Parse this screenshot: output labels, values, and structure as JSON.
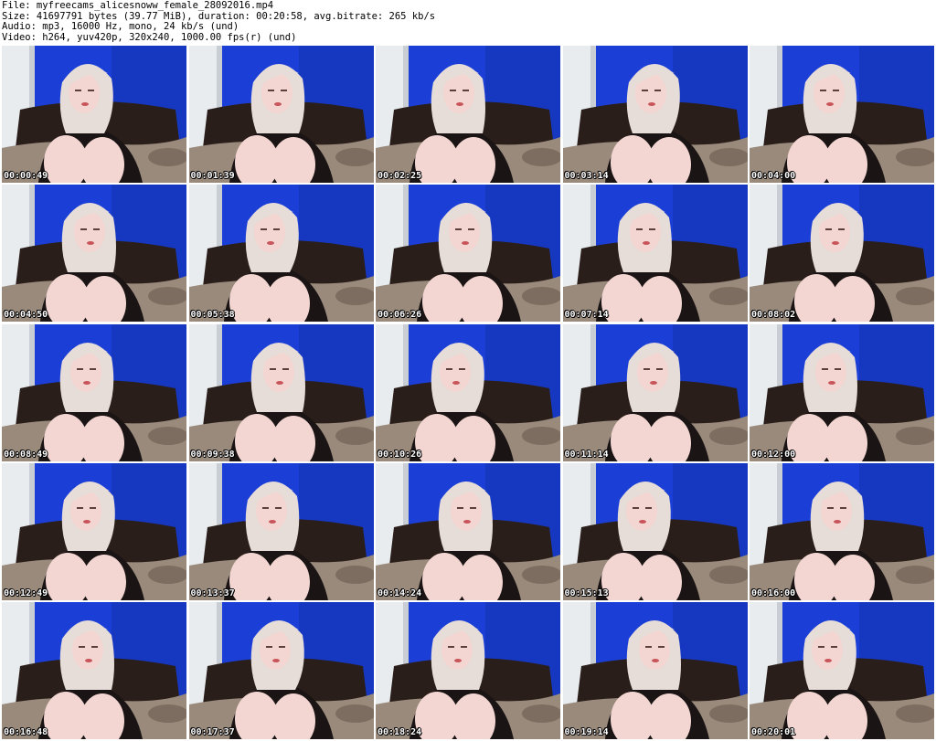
{
  "header": {
    "file_line": "File: myfreecams_alicesnoww_female_28092016.mp4",
    "size_line": "Size: 41697791 bytes (39.77 MiB), duration: 00:20:58, avg.bitrate: 265 kb/s",
    "audio_line": "Audio: mp3, 16000 Hz, mono, 24 kb/s (und)",
    "video_line": "Video: h264, yuv420p, 320x240, 1000.00 fps(r) (und)"
  },
  "colors": {
    "wall_blue": "#1b3fd6",
    "wall_blue_dark": "#0f2a9a",
    "door_white": "#e8ecef",
    "hair": "#e6dcd8",
    "skin": "#f3d6d2",
    "shirt": "#1a1414",
    "headboard": "#2a1e1a",
    "bedding": "#9a8a7c"
  },
  "thumbnails": [
    {
      "timestamp": "00:00:49"
    },
    {
      "timestamp": "00:01:39"
    },
    {
      "timestamp": "00:02:25"
    },
    {
      "timestamp": "00:03:14"
    },
    {
      "timestamp": "00:04:00"
    },
    {
      "timestamp": "00:04:50"
    },
    {
      "timestamp": "00:05:38"
    },
    {
      "timestamp": "00:06:26"
    },
    {
      "timestamp": "00:07:14"
    },
    {
      "timestamp": "00:08:02"
    },
    {
      "timestamp": "00:08:49"
    },
    {
      "timestamp": "00:09:38"
    },
    {
      "timestamp": "00:10:26"
    },
    {
      "timestamp": "00:11:14"
    },
    {
      "timestamp": "00:12:00"
    },
    {
      "timestamp": "00:12:49"
    },
    {
      "timestamp": "00:13:37"
    },
    {
      "timestamp": "00:14:24"
    },
    {
      "timestamp": "00:15:13"
    },
    {
      "timestamp": "00:16:00"
    },
    {
      "timestamp": "00:16:48"
    },
    {
      "timestamp": "00:17:37"
    },
    {
      "timestamp": "00:18:24"
    },
    {
      "timestamp": "00:19:14"
    },
    {
      "timestamp": "00:20:01"
    }
  ]
}
